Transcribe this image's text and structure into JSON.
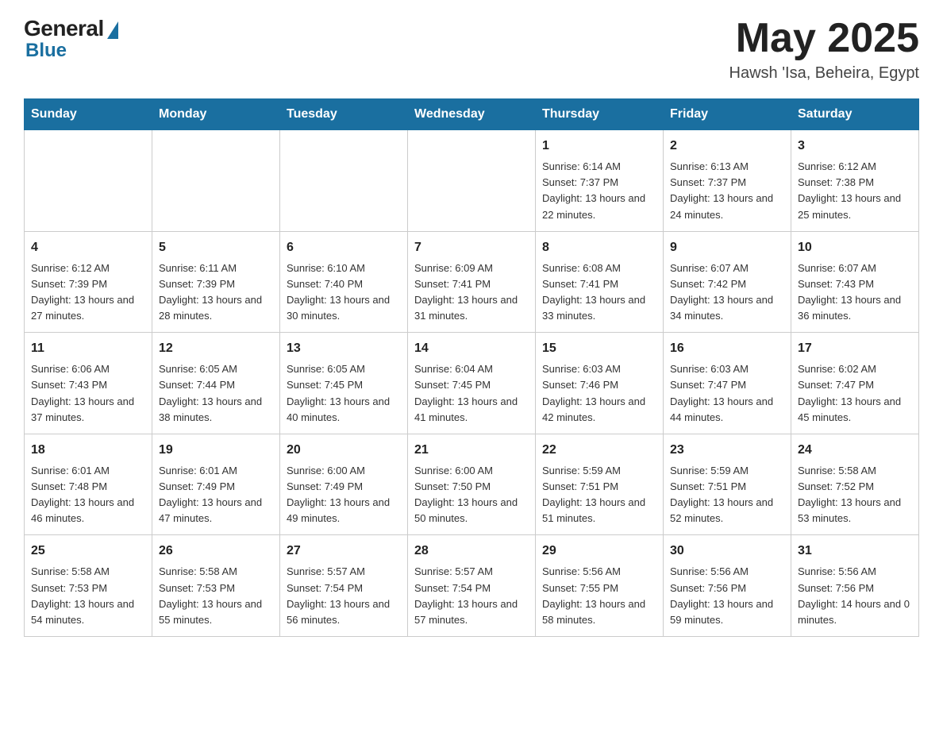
{
  "header": {
    "logo_general": "General",
    "logo_blue": "Blue",
    "month_year": "May 2025",
    "location": "Hawsh 'Isa, Beheira, Egypt"
  },
  "days_of_week": [
    "Sunday",
    "Monday",
    "Tuesday",
    "Wednesday",
    "Thursday",
    "Friday",
    "Saturday"
  ],
  "weeks": [
    [
      {
        "day": "",
        "sunrise": "",
        "sunset": "",
        "daylight": ""
      },
      {
        "day": "",
        "sunrise": "",
        "sunset": "",
        "daylight": ""
      },
      {
        "day": "",
        "sunrise": "",
        "sunset": "",
        "daylight": ""
      },
      {
        "day": "",
        "sunrise": "",
        "sunset": "",
        "daylight": ""
      },
      {
        "day": "1",
        "sunrise": "Sunrise: 6:14 AM",
        "sunset": "Sunset: 7:37 PM",
        "daylight": "Daylight: 13 hours and 22 minutes."
      },
      {
        "day": "2",
        "sunrise": "Sunrise: 6:13 AM",
        "sunset": "Sunset: 7:37 PM",
        "daylight": "Daylight: 13 hours and 24 minutes."
      },
      {
        "day": "3",
        "sunrise": "Sunrise: 6:12 AM",
        "sunset": "Sunset: 7:38 PM",
        "daylight": "Daylight: 13 hours and 25 minutes."
      }
    ],
    [
      {
        "day": "4",
        "sunrise": "Sunrise: 6:12 AM",
        "sunset": "Sunset: 7:39 PM",
        "daylight": "Daylight: 13 hours and 27 minutes."
      },
      {
        "day": "5",
        "sunrise": "Sunrise: 6:11 AM",
        "sunset": "Sunset: 7:39 PM",
        "daylight": "Daylight: 13 hours and 28 minutes."
      },
      {
        "day": "6",
        "sunrise": "Sunrise: 6:10 AM",
        "sunset": "Sunset: 7:40 PM",
        "daylight": "Daylight: 13 hours and 30 minutes."
      },
      {
        "day": "7",
        "sunrise": "Sunrise: 6:09 AM",
        "sunset": "Sunset: 7:41 PM",
        "daylight": "Daylight: 13 hours and 31 minutes."
      },
      {
        "day": "8",
        "sunrise": "Sunrise: 6:08 AM",
        "sunset": "Sunset: 7:41 PM",
        "daylight": "Daylight: 13 hours and 33 minutes."
      },
      {
        "day": "9",
        "sunrise": "Sunrise: 6:07 AM",
        "sunset": "Sunset: 7:42 PM",
        "daylight": "Daylight: 13 hours and 34 minutes."
      },
      {
        "day": "10",
        "sunrise": "Sunrise: 6:07 AM",
        "sunset": "Sunset: 7:43 PM",
        "daylight": "Daylight: 13 hours and 36 minutes."
      }
    ],
    [
      {
        "day": "11",
        "sunrise": "Sunrise: 6:06 AM",
        "sunset": "Sunset: 7:43 PM",
        "daylight": "Daylight: 13 hours and 37 minutes."
      },
      {
        "day": "12",
        "sunrise": "Sunrise: 6:05 AM",
        "sunset": "Sunset: 7:44 PM",
        "daylight": "Daylight: 13 hours and 38 minutes."
      },
      {
        "day": "13",
        "sunrise": "Sunrise: 6:05 AM",
        "sunset": "Sunset: 7:45 PM",
        "daylight": "Daylight: 13 hours and 40 minutes."
      },
      {
        "day": "14",
        "sunrise": "Sunrise: 6:04 AM",
        "sunset": "Sunset: 7:45 PM",
        "daylight": "Daylight: 13 hours and 41 minutes."
      },
      {
        "day": "15",
        "sunrise": "Sunrise: 6:03 AM",
        "sunset": "Sunset: 7:46 PM",
        "daylight": "Daylight: 13 hours and 42 minutes."
      },
      {
        "day": "16",
        "sunrise": "Sunrise: 6:03 AM",
        "sunset": "Sunset: 7:47 PM",
        "daylight": "Daylight: 13 hours and 44 minutes."
      },
      {
        "day": "17",
        "sunrise": "Sunrise: 6:02 AM",
        "sunset": "Sunset: 7:47 PM",
        "daylight": "Daylight: 13 hours and 45 minutes."
      }
    ],
    [
      {
        "day": "18",
        "sunrise": "Sunrise: 6:01 AM",
        "sunset": "Sunset: 7:48 PM",
        "daylight": "Daylight: 13 hours and 46 minutes."
      },
      {
        "day": "19",
        "sunrise": "Sunrise: 6:01 AM",
        "sunset": "Sunset: 7:49 PM",
        "daylight": "Daylight: 13 hours and 47 minutes."
      },
      {
        "day": "20",
        "sunrise": "Sunrise: 6:00 AM",
        "sunset": "Sunset: 7:49 PM",
        "daylight": "Daylight: 13 hours and 49 minutes."
      },
      {
        "day": "21",
        "sunrise": "Sunrise: 6:00 AM",
        "sunset": "Sunset: 7:50 PM",
        "daylight": "Daylight: 13 hours and 50 minutes."
      },
      {
        "day": "22",
        "sunrise": "Sunrise: 5:59 AM",
        "sunset": "Sunset: 7:51 PM",
        "daylight": "Daylight: 13 hours and 51 minutes."
      },
      {
        "day": "23",
        "sunrise": "Sunrise: 5:59 AM",
        "sunset": "Sunset: 7:51 PM",
        "daylight": "Daylight: 13 hours and 52 minutes."
      },
      {
        "day": "24",
        "sunrise": "Sunrise: 5:58 AM",
        "sunset": "Sunset: 7:52 PM",
        "daylight": "Daylight: 13 hours and 53 minutes."
      }
    ],
    [
      {
        "day": "25",
        "sunrise": "Sunrise: 5:58 AM",
        "sunset": "Sunset: 7:53 PM",
        "daylight": "Daylight: 13 hours and 54 minutes."
      },
      {
        "day": "26",
        "sunrise": "Sunrise: 5:58 AM",
        "sunset": "Sunset: 7:53 PM",
        "daylight": "Daylight: 13 hours and 55 minutes."
      },
      {
        "day": "27",
        "sunrise": "Sunrise: 5:57 AM",
        "sunset": "Sunset: 7:54 PM",
        "daylight": "Daylight: 13 hours and 56 minutes."
      },
      {
        "day": "28",
        "sunrise": "Sunrise: 5:57 AM",
        "sunset": "Sunset: 7:54 PM",
        "daylight": "Daylight: 13 hours and 57 minutes."
      },
      {
        "day": "29",
        "sunrise": "Sunrise: 5:56 AM",
        "sunset": "Sunset: 7:55 PM",
        "daylight": "Daylight: 13 hours and 58 minutes."
      },
      {
        "day": "30",
        "sunrise": "Sunrise: 5:56 AM",
        "sunset": "Sunset: 7:56 PM",
        "daylight": "Daylight: 13 hours and 59 minutes."
      },
      {
        "day": "31",
        "sunrise": "Sunrise: 5:56 AM",
        "sunset": "Sunset: 7:56 PM",
        "daylight": "Daylight: 14 hours and 0 minutes."
      }
    ]
  ]
}
